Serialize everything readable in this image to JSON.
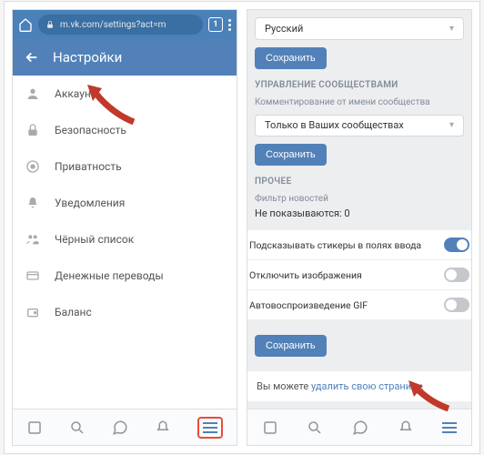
{
  "browser": {
    "url": "m.vk.com/settings?act=m",
    "tab_count": "1"
  },
  "header": {
    "title": "Настройки"
  },
  "settings": {
    "items": [
      {
        "label": "Аккаунт",
        "icon": "user"
      },
      {
        "label": "Безопасность",
        "icon": "lock"
      },
      {
        "label": "Приватность",
        "icon": "privacy"
      },
      {
        "label": "Уведомления",
        "icon": "bell"
      },
      {
        "label": "Чёрный список",
        "icon": "blacklist"
      },
      {
        "label": "Денежные переводы",
        "icon": "card"
      },
      {
        "label": "Баланс",
        "icon": "balance"
      }
    ]
  },
  "right": {
    "language_value": "Русский",
    "save_label": "Сохранить",
    "section_communities": "УПРАВЛЕНИЕ СООБЩЕСТВАМИ",
    "comment_label": "Комментирование от имени сообщества",
    "communities_value": "Только в Ваших сообществах",
    "section_other": "ПРОЧЕЕ",
    "filter_label": "Фильтр новостей",
    "filter_value": "Не показываются: 0",
    "toggle1": "Подсказывать стикеры в полях ввода",
    "toggle2": "Отключить изображения",
    "toggle3": "Автовоспроизведение GIF",
    "delete_prefix": "Вы можете ",
    "delete_link": "удалить свою страницу."
  }
}
